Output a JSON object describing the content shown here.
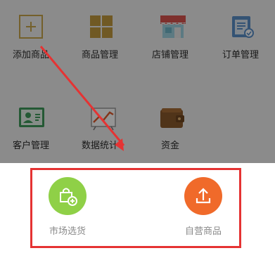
{
  "grid": {
    "items": [
      {
        "label": "添加商品",
        "icon": "add-icon"
      },
      {
        "label": "商品管理",
        "icon": "product-grid-icon"
      },
      {
        "label": "店铺管理",
        "icon": "shop-icon"
      },
      {
        "label": "订单管理",
        "icon": "clipboard-icon"
      },
      {
        "label": "客户管理",
        "icon": "id-card-icon"
      },
      {
        "label": "数据统计",
        "icon": "chart-icon"
      },
      {
        "label": "资金",
        "icon": "wallet-icon"
      }
    ]
  },
  "sheet": {
    "left_label": "市场选货",
    "right_label": "自营商品",
    "left_color": "#8fd047",
    "right_color": "#f06a2a"
  },
  "colors": {
    "annotation_red": "#e53333",
    "overlay": "rgba(0,0,0,0.42)"
  }
}
